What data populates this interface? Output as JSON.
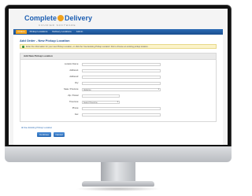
{
  "app": {
    "brand_part1": "Complete",
    "brand_part2": "Delivery",
    "brand_tagline": "COURIER SOFTWARE"
  },
  "nav": {
    "tabs": [
      {
        "label": "Orders",
        "active": true
      },
      {
        "label": "Pickup Locations",
        "active": false
      },
      {
        "label": "Delivery Locations",
        "active": false
      },
      {
        "label": "Admin",
        "active": false
      }
    ]
  },
  "page": {
    "title": "Add Order - New Pickup Location",
    "notice": "Enter the information for your new Pickup Location, or click the 'Use Existing Pickup Location' link to choose an existing pickup location."
  },
  "form": {
    "heading": "Add New Pickup Location",
    "fields": [
      {
        "label": "Location Name:",
        "value": ""
      },
      {
        "label": "Address1:",
        "value": ""
      },
      {
        "label": "Address2:",
        "value": ""
      },
      {
        "label": "City:",
        "value": ""
      },
      {
        "label": "State / Province:",
        "value": "Alabama"
      },
      {
        "label": "Zip / Postal:",
        "value": ""
      },
      {
        "label": "Timezone:",
        "value": "Select Timezone"
      },
      {
        "label": "Phone:",
        "value": ""
      },
      {
        "label": "Fax:",
        "value": ""
      }
    ],
    "use_existing_link": "Use Existing Pickup Location",
    "continue_label": "Continue",
    "cancel_label": "Cancel"
  },
  "colors": {
    "brand_blue": "#1e5fb2",
    "brand_orange": "#f0a21c",
    "nav_blue": "#2b6bb5"
  }
}
